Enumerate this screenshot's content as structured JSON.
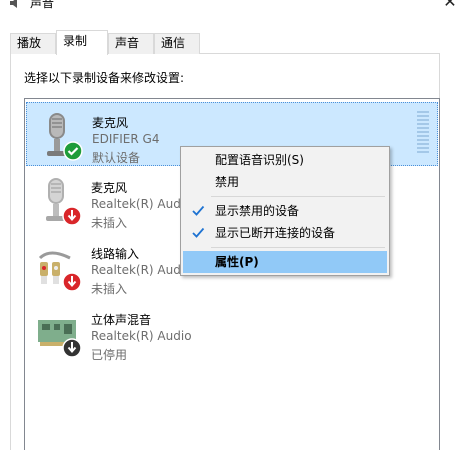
{
  "window": {
    "title": "声音",
    "close_glyph": "✕",
    "title_icon": "speaker-icon"
  },
  "tabs": [
    {
      "label": "播放",
      "active": false
    },
    {
      "label": "录制",
      "active": true
    },
    {
      "label": "声音",
      "active": false
    },
    {
      "label": "通信",
      "active": false
    }
  ],
  "instruction": "选择以下录制设备来修改设置:",
  "devices": [
    {
      "name": "麦克风",
      "driver": "EDIFIER G4",
      "status": "默认设备",
      "icon": "microphone-icon",
      "badge": "default-check-icon",
      "selected": true
    },
    {
      "name": "麦克风",
      "driver": "Realtek(R) Audio",
      "status": "未插入",
      "icon": "microphone-icon",
      "badge": "unplugged-arrow-icon",
      "selected": false
    },
    {
      "name": "线路输入",
      "driver": "Realtek(R) Audio",
      "status": "未插入",
      "icon": "line-in-cable-icon",
      "badge": "unplugged-arrow-icon",
      "selected": false
    },
    {
      "name": "立体声混音",
      "driver": "Realtek(R) Audio",
      "status": "已停用",
      "icon": "sound-card-icon",
      "badge": "disabled-arrow-icon",
      "selected": false
    }
  ],
  "context_menu": {
    "items": [
      {
        "label": "配置语音识别(S)",
        "checked": false,
        "highlighted": false
      },
      {
        "label": "禁用",
        "checked": false,
        "highlighted": false
      },
      {
        "label": "显示禁用的设备",
        "checked": true,
        "highlighted": false
      },
      {
        "label": "显示已断开连接的设备",
        "checked": true,
        "highlighted": false
      },
      {
        "label": "属性(P)",
        "checked": false,
        "highlighted": true
      }
    ]
  },
  "colors": {
    "selection_bg": "#cce8ff",
    "menu_highlight": "#91c9f7",
    "check_blue": "#1e73d2",
    "default_badge_green": "#1e9c3a",
    "unplugged_badge_red": "#d9262a"
  }
}
